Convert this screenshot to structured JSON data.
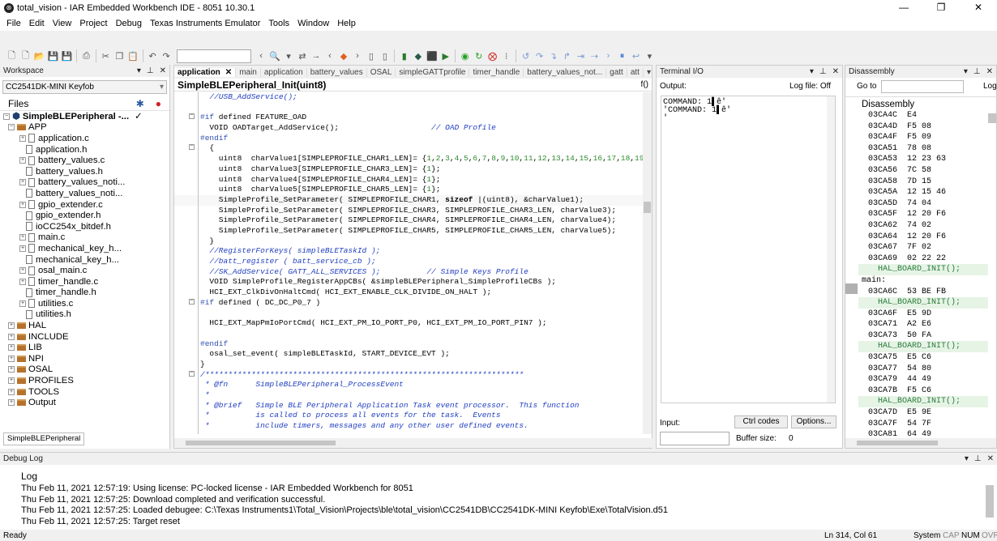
{
  "window": {
    "title": "total_vision - IAR Embedded Workbench IDE - 8051 10.30.1",
    "minimize": "—",
    "maximize": "❐",
    "close": "✕"
  },
  "menu": [
    "File",
    "Edit",
    "View",
    "Project",
    "Debug",
    "Texas Instruments Emulator",
    "Tools",
    "Window",
    "Help"
  ],
  "workspace": {
    "header": "Workspace",
    "config": "CC2541DK-MINI Keyfob",
    "files_label": "Files",
    "tab": "SimpleBLEPeripheral",
    "project": "SimpleBLEPeripheral -...",
    "tree": [
      {
        "label": "APP",
        "type": "folder",
        "level": 1,
        "expander": "−"
      },
      {
        "label": "application.c",
        "type": "file",
        "level": 2,
        "expander": "+"
      },
      {
        "label": "application.h",
        "type": "file",
        "level": 2,
        "expander": ""
      },
      {
        "label": "battery_values.c",
        "type": "file",
        "level": 2,
        "expander": "+"
      },
      {
        "label": "battery_values.h",
        "type": "file",
        "level": 2,
        "expander": ""
      },
      {
        "label": "battery_values_noti...",
        "type": "file",
        "level": 2,
        "expander": "+"
      },
      {
        "label": "battery_values_noti...",
        "type": "file",
        "level": 2,
        "expander": ""
      },
      {
        "label": "gpio_extender.c",
        "type": "file",
        "level": 2,
        "expander": "+"
      },
      {
        "label": "gpio_extender.h",
        "type": "file",
        "level": 2,
        "expander": ""
      },
      {
        "label": "ioCC254x_bitdef.h",
        "type": "file",
        "level": 2,
        "expander": ""
      },
      {
        "label": "main.c",
        "type": "file",
        "level": 2,
        "expander": "+"
      },
      {
        "label": "mechanical_key_h...",
        "type": "file",
        "level": 2,
        "expander": "+"
      },
      {
        "label": "mechanical_key_h...",
        "type": "file",
        "level": 2,
        "expander": ""
      },
      {
        "label": "osal_main.c",
        "type": "file",
        "level": 2,
        "expander": "+"
      },
      {
        "label": "timer_handle.c",
        "type": "file",
        "level": 2,
        "expander": "+"
      },
      {
        "label": "timer_handle.h",
        "type": "file",
        "level": 2,
        "expander": ""
      },
      {
        "label": "utilities.c",
        "type": "file",
        "level": 2,
        "expander": "+"
      },
      {
        "label": "utilities.h",
        "type": "file",
        "level": 2,
        "expander": ""
      },
      {
        "label": "HAL",
        "type": "folder",
        "level": 1,
        "expander": "+"
      },
      {
        "label": "INCLUDE",
        "type": "folder",
        "level": 1,
        "expander": "+"
      },
      {
        "label": "LIB",
        "type": "folder",
        "level": 1,
        "expander": "+"
      },
      {
        "label": "NPI",
        "type": "folder",
        "level": 1,
        "expander": "+"
      },
      {
        "label": "OSAL",
        "type": "folder",
        "level": 1,
        "expander": "+"
      },
      {
        "label": "PROFILES",
        "type": "folder",
        "level": 1,
        "expander": "+"
      },
      {
        "label": "TOOLS",
        "type": "folder",
        "level": 1,
        "expander": "+"
      },
      {
        "label": "Output",
        "type": "folder",
        "level": 1,
        "expander": "+"
      }
    ]
  },
  "editor": {
    "tabs": [
      "application",
      "main",
      "application",
      "battery_values",
      "OSAL",
      "simpleGATTprofile",
      "timer_handle",
      "battery_values_not...",
      "gatt",
      "att"
    ],
    "function": "SimpleBLEPeripheral_Init(uint8)",
    "func_icon": "f()",
    "code": [
      {
        "html": "  <span class=\"cmt\">//USB_AddService();</span>",
        "fold": ""
      },
      {
        "html": "",
        "fold": ""
      },
      {
        "html": "<span class=\"pp\">#if</span> defined FEATURE_OAD",
        "fold": "−"
      },
      {
        "html": "  VOID OADTarget_AddService();                    <span class=\"cmt\">// OAD Profile</span>",
        "fold": ""
      },
      {
        "html": "<span class=\"pp\">#endif</span>",
        "fold": ""
      },
      {
        "html": "  {",
        "fold": "−"
      },
      {
        "html": "    uint8  charValue1[SIMPLEPROFILE_CHAR1_LEN]= {<span class=\"num\">1</span>,<span class=\"num\">2</span>,<span class=\"num\">3</span>,<span class=\"num\">4</span>,<span class=\"num\">5</span>,<span class=\"num\">6</span>,<span class=\"num\">7</span>,<span class=\"num\">8</span>,<span class=\"num\">9</span>,<span class=\"num\">10</span>,<span class=\"num\">11</span>,<span class=\"num\">12</span>,<span class=\"num\">13</span>,<span class=\"num\">14</span>,<span class=\"num\">15</span>,<span class=\"num\">16</span>,<span class=\"num\">17</span>,<span class=\"num\">18</span>,<span class=\"num\">19</span>",
        "fold": ""
      },
      {
        "html": "    uint8  charValue3[SIMPLEPROFILE_CHAR3_LEN]= {<span class=\"num\">1</span>};",
        "fold": ""
      },
      {
        "html": "    uint8  charValue4[SIMPLEPROFILE_CHAR4_LEN]= {<span class=\"num\">1</span>};",
        "fold": ""
      },
      {
        "html": "    uint8  charValue5[SIMPLEPROFILE_CHAR5_LEN]= {<span class=\"num\">1</span>};",
        "fold": ""
      },
      {
        "html": "    SimpleProfile_SetParameter( SIMPLEPROFILE_CHAR1, <span class=\"kw\">sizeof</span> |(uint8), &amp;charValue1);",
        "fold": ""
      },
      {
        "html": "    SimpleProfile_SetParameter( SIMPLEPROFILE_CHAR3, SIMPLEPROFILE_CHAR3_LEN, charValue3);",
        "fold": ""
      },
      {
        "html": "    SimpleProfile_SetParameter( SIMPLEPROFILE_CHAR4, SIMPLEPROFILE_CHAR4_LEN, charValue4);",
        "fold": ""
      },
      {
        "html": "    SimpleProfile_SetParameter( SIMPLEPROFILE_CHAR5, SIMPLEPROFILE_CHAR5_LEN, charValue5);",
        "fold": ""
      },
      {
        "html": "  }",
        "fold": ""
      },
      {
        "html": "  <span class=\"cmt\">//RegisterForKeys( simpleBLETaskId );</span>",
        "fold": ""
      },
      {
        "html": "  <span class=\"cmt\">//batt_register ( batt_service_cb );</span>",
        "fold": ""
      },
      {
        "html": "  <span class=\"cmt\">//SK_AddService( GATT_ALL_SERVICES );</span>          <span class=\"cmt\">// Simple Keys Profile</span>",
        "fold": ""
      },
      {
        "html": "  VOID SimpleProfile_RegisterAppCBs( &amp;simpleBLEPeripheral_SimpleProfileCBs );",
        "fold": ""
      },
      {
        "html": "  HCI_EXT_ClkDivOnHaltCmd( HCI_EXT_ENABLE_CLK_DIVIDE_ON_HALT );",
        "fold": ""
      },
      {
        "html": "<span class=\"pp\">#if</span> defined ( DC_DC_P0_7 )",
        "fold": "−"
      },
      {
        "html": "",
        "fold": ""
      },
      {
        "html": "  HCI_EXT_MapPmIoPortCmd( HCI_EXT_PM_IO_PORT_P0, HCI_EXT_PM_IO_PORT_PIN7 );",
        "fold": ""
      },
      {
        "html": "",
        "fold": ""
      },
      {
        "html": "<span class=\"pp\">#endif</span>",
        "fold": ""
      },
      {
        "html": "  osal_set_event( simpleBLETaskId, START_DEVICE_EVT );",
        "fold": ""
      },
      {
        "html": "}",
        "fold": ""
      },
      {
        "html": "<span class=\"cmt\">/*********************************************************************</span>",
        "fold": "−"
      },
      {
        "html": "<span class=\"cmt\"> * @fn      SimpleBLEPeripheral_ProcessEvent</span>",
        "fold": ""
      },
      {
        "html": "<span class=\"cmt\"> *</span>",
        "fold": ""
      },
      {
        "html": "<span class=\"cmt\"> * @brief   Simple BLE Peripheral Application Task event processor.  This function</span>",
        "fold": ""
      },
      {
        "html": "<span class=\"cmt\"> *          is called to process all events for the task.  Events</span>",
        "fold": ""
      },
      {
        "html": "<span class=\"cmt\"> *          include timers, messages and any other user defined events.</span>",
        "fold": ""
      }
    ]
  },
  "terminal": {
    "header": "Terminal I/O",
    "output_label": "Output:",
    "logfile": "Log file: Off",
    "lines": [
      "COMMAND: 1▌ê'",
      "'COMMAND: 1▌ê'",
      "'"
    ],
    "input_label": "Input:",
    "ctrl_codes": "Ctrl codes",
    "options": "Options...",
    "buffer_label": "Buffer size:",
    "buffer_value": "0"
  },
  "disassembly": {
    "header": "Disassembly",
    "goto_label": "Go to",
    "logical_label": "LogicalC",
    "title": "Disassembly",
    "lines": [
      {
        "text": "03CA4C  E4",
        "kind": "asm"
      },
      {
        "text": "03CA4D  F5 08",
        "kind": "asm"
      },
      {
        "text": "03CA4F  F5 09",
        "kind": "asm"
      },
      {
        "text": "03CA51  78 08",
        "kind": "asm"
      },
      {
        "text": "03CA53  12 23 63",
        "kind": "asm"
      },
      {
        "text": "03CA56  7C 58",
        "kind": "asm"
      },
      {
        "text": "03CA58  7D 15",
        "kind": "asm"
      },
      {
        "text": "03CA5A  12 15 46",
        "kind": "asm"
      },
      {
        "text": "03CA5D  74 04",
        "kind": "asm"
      },
      {
        "text": "03CA5F  12 20 F6",
        "kind": "asm"
      },
      {
        "text": "03CA62  74 02",
        "kind": "asm"
      },
      {
        "text": "03CA64  12 20 F6",
        "kind": "asm"
      },
      {
        "text": "03CA67  7F 02",
        "kind": "asm"
      },
      {
        "text": "03CA69  02 22 22",
        "kind": "asm"
      },
      {
        "text": "HAL_BOARD_INIT();",
        "kind": "src"
      },
      {
        "text": "main:",
        "kind": "lbl"
      },
      {
        "text": "03CA6C  53 BE FB",
        "kind": "asm"
      },
      {
        "text": "HAL_BOARD_INIT();",
        "kind": "src"
      },
      {
        "text": "03CA6F  E5 9D",
        "kind": "asm"
      },
      {
        "text": "03CA71  A2 E6",
        "kind": "asm"
      },
      {
        "text": "03CA73  50 FA",
        "kind": "asm"
      },
      {
        "text": "HAL_BOARD_INIT();",
        "kind": "src"
      },
      {
        "text": "03CA75  E5 C6",
        "kind": "asm"
      },
      {
        "text": "03CA77  54 80",
        "kind": "asm"
      },
      {
        "text": "03CA79  44 49",
        "kind": "asm"
      },
      {
        "text": "03CA7B  F5 C6",
        "kind": "asm"
      },
      {
        "text": "HAL_BOARD_INIT();",
        "kind": "src"
      },
      {
        "text": "03CA7D  E5 9E",
        "kind": "asm"
      },
      {
        "text": "03CA7F  54 7F",
        "kind": "asm"
      },
      {
        "text": "03CA81  64 49",
        "kind": "asm"
      }
    ]
  },
  "debuglog": {
    "header": "Debug Log",
    "title": "Log",
    "lines": [
      "Thu Feb 11, 2021 12:57:19: Using license: PC-locked license - IAR Embedded Workbench for 8051",
      "Thu Feb 11, 2021 12:57:25: Download completed and verification successful.",
      "Thu Feb 11, 2021 12:57:25: Loaded debugee: C:\\Texas Instruments1\\Total_Vision\\Projects\\ble\\total_vision\\CC2541DB\\CC2541DK-MINI Keyfob\\Exe\\TotalVision.d51",
      "Thu Feb 11, 2021 12:57:25: Target reset"
    ]
  },
  "status": {
    "left": "Ready",
    "pos": "Ln 314, Col 61",
    "system": "System",
    "caps": "CAP",
    "num": "NUM",
    "ovr": "OVR"
  }
}
